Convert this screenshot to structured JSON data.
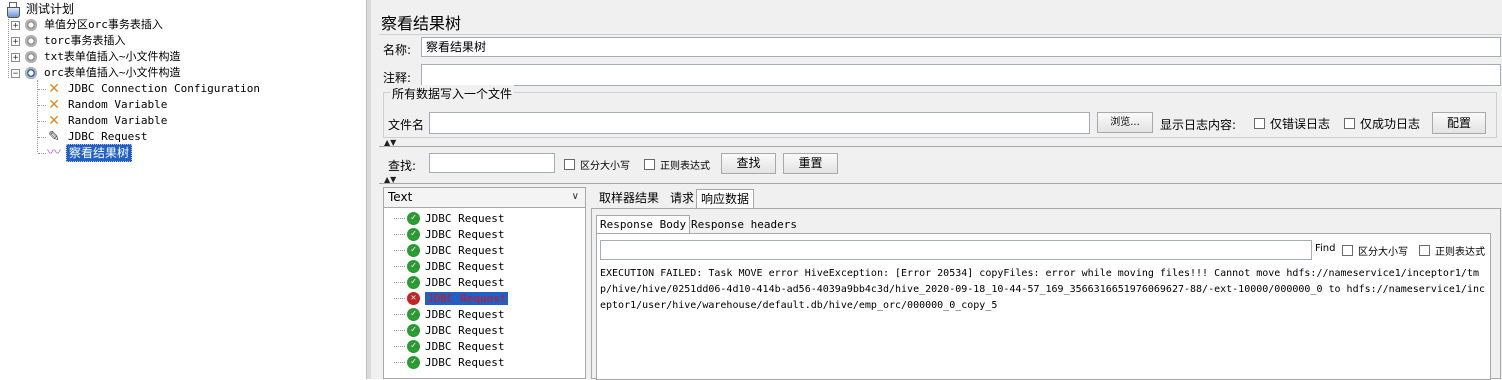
{
  "tree": {
    "root": {
      "label": "测试计划",
      "icon": "test-plan-flask-icon"
    },
    "groups": [
      {
        "label": "单值分区orc事务表插入",
        "expander": "+"
      },
      {
        "label": "torc事务表插入",
        "expander": "+"
      },
      {
        "label": "txt表单值插入~小文件构造",
        "expander": "+"
      },
      {
        "label": "orc表单值插入~小文件构造",
        "expander": "−"
      }
    ],
    "children": [
      {
        "label": "JDBC Connection Configuration",
        "icon": "config-wrench-icon"
      },
      {
        "label": "Random Variable",
        "icon": "config-wrench-icon"
      },
      {
        "label": "Random Variable",
        "icon": "config-wrench-icon"
      },
      {
        "label": "JDBC Request",
        "icon": "sampler-pen-icon"
      },
      {
        "label": "察看结果树",
        "icon": "listener-chart-icon"
      }
    ]
  },
  "panel": {
    "title": "察看结果树",
    "name_label": "名称:",
    "name_value": "察看结果树",
    "comment_label": "注释:",
    "comment_value": "",
    "file_group_title": "所有数据写入一个文件",
    "file_label": "文件名",
    "file_value": "",
    "browse_label": "浏览...",
    "log_label": "显示日志内容:",
    "errors_only": "仅错误日志",
    "success_only": "仅成功日志",
    "config_label": "配置"
  },
  "search": {
    "label": "查找:",
    "value": "",
    "case_label": "区分大小写",
    "regex_label": "正则表达式",
    "find_button": "查找",
    "reset_button": "重置"
  },
  "results": {
    "renderer": "Text",
    "samples": [
      {
        "label": "JDBC Request",
        "status": "ok"
      },
      {
        "label": "JDBC Request",
        "status": "ok"
      },
      {
        "label": "JDBC Request",
        "status": "ok"
      },
      {
        "label": "JDBC Request",
        "status": "ok"
      },
      {
        "label": "JDBC Request",
        "status": "ok"
      },
      {
        "label": "JDBC Request",
        "status": "error"
      },
      {
        "label": "JDBC Request",
        "status": "ok"
      },
      {
        "label": "JDBC Request",
        "status": "ok"
      },
      {
        "label": "JDBC Request",
        "status": "ok"
      },
      {
        "label": "JDBC Request",
        "status": "ok"
      }
    ]
  },
  "details": {
    "tabs": [
      "取样器结果",
      "请求",
      "响应数据"
    ],
    "subtabs": [
      "Response Body",
      "Response headers"
    ],
    "find_label": "Find",
    "case_label": "区分大小写",
    "regex_label": "正则表达式",
    "response_body": "EXECUTION FAILED: Task MOVE error HiveException: [Error 20534] copyFiles: error while moving files!!! Cannot move hdfs://nameservice1/inceptor1/tmp/hive/hive/0251dd06-4d10-414b-ad56-4039a9bb4c3d/hive_2020-09-18_10-44-57_169_356631665197606962​7-88/-ext-10000/000000_0 to hdfs://nameservice1/inceptor1/user/hive/warehouse/default.db/hive/emp_orc/000000_0_copy_5"
  }
}
